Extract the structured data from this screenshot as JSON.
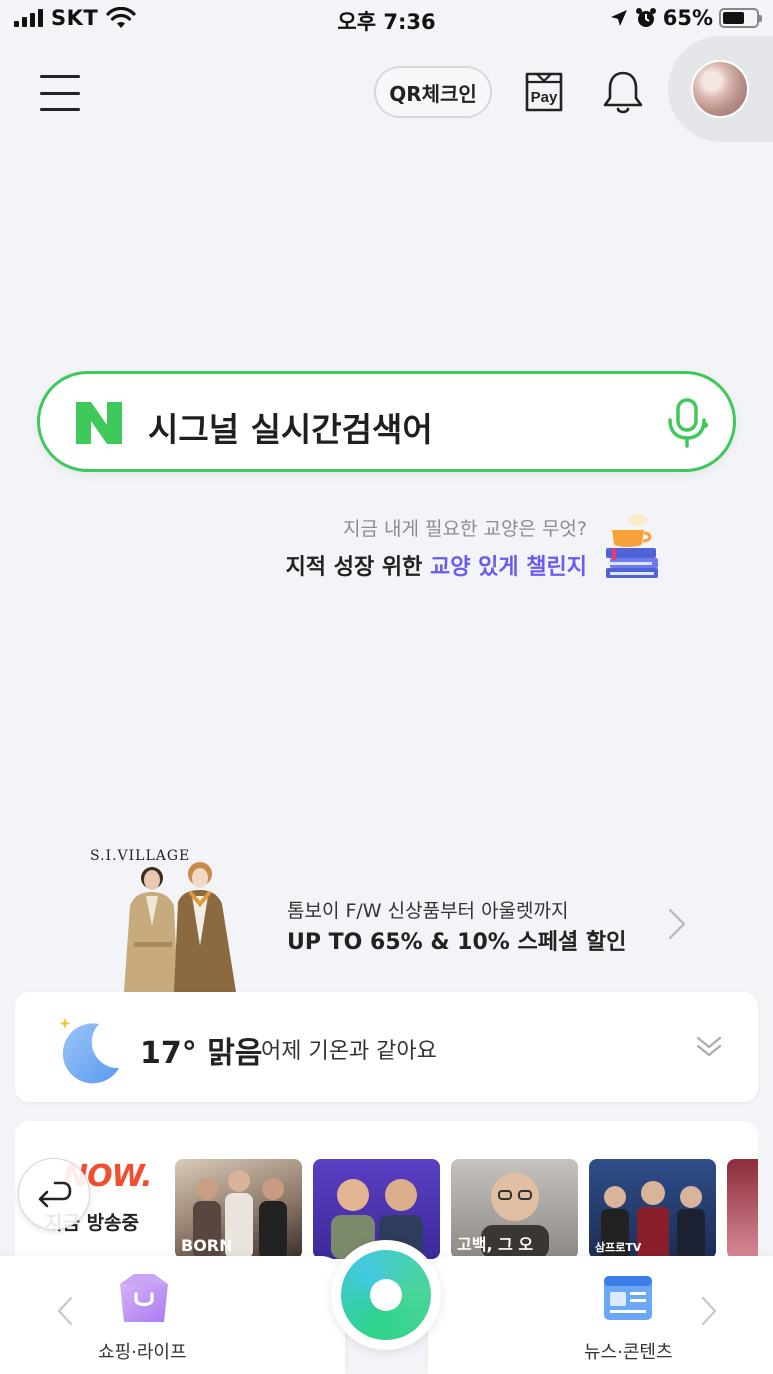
{
  "status_bar": {
    "carrier": "SKT",
    "time": "오후 7:36",
    "battery": "65%",
    "battery_level": 0.65
  },
  "header": {
    "qr_label": "QR체크인",
    "pay_label": "Pay"
  },
  "search": {
    "text": "시그널 실시간검색어",
    "brand_letter": "N"
  },
  "promo": {
    "subtitle": "지금 내게 필요한 교양은 무엇?",
    "main_prefix": "지적 성장 위한",
    "main_accent": "교양 있게 챌린지",
    "accent_color": "#6a5cf2"
  },
  "ad": {
    "brand": "S.I.VILLAGE",
    "line1": "톰보이 F/W 신상품부터 아울렛까지",
    "line2": "UP TO 65% & 10% 스페셜 할인"
  },
  "weather": {
    "temperature": "17° 맑음",
    "description": "어제 기온과 같아요"
  },
  "now": {
    "logo": "NOW.",
    "label": "지금 방송중",
    "thumbnails": [
      {
        "overlay": "BORN"
      },
      {
        "overlay": ""
      },
      {
        "overlay": "고백, 그 오"
      },
      {
        "overlay": "삼프로TV"
      },
      {
        "overlay": ""
      }
    ]
  },
  "bottom_nav": {
    "left_label": "쇼핑·라이프",
    "right_label": "뉴스·콘텐츠"
  },
  "colors": {
    "naver_green": "#3ec95a",
    "now_red": "#f04e2f",
    "background": "#f3f4f7"
  }
}
